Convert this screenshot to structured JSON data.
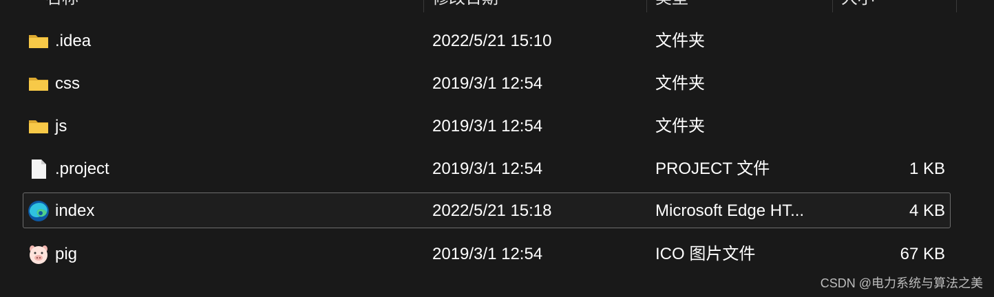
{
  "header": {
    "columns": [
      "名称",
      "修改日期",
      "类型",
      "大小"
    ]
  },
  "files": [
    {
      "icon": "folder-icon",
      "name": ".idea",
      "date": "2022/5/21 15:10",
      "type": "文件夹",
      "size": ""
    },
    {
      "icon": "folder-icon",
      "name": "css",
      "date": "2019/3/1 12:54",
      "type": "文件夹",
      "size": ""
    },
    {
      "icon": "folder-icon",
      "name": "js",
      "date": "2019/3/1 12:54",
      "type": "文件夹",
      "size": ""
    },
    {
      "icon": "file-icon",
      "name": ".project",
      "date": "2019/3/1 12:54",
      "type": "PROJECT 文件",
      "size": "1 KB"
    },
    {
      "icon": "edge-icon",
      "name": "index",
      "date": "2022/5/21 15:18",
      "type": "Microsoft Edge HT...",
      "size": "4 KB",
      "selected": true
    },
    {
      "icon": "pig-icon",
      "name": "pig",
      "date": "2019/3/1 12:54",
      "type": "ICO 图片文件",
      "size": "67 KB"
    }
  ],
  "watermark": "CSDN @电力系统与算法之美",
  "colors": {
    "background": "#191919",
    "folder": "#f7c948",
    "selection_border": "#6e6e6e"
  }
}
